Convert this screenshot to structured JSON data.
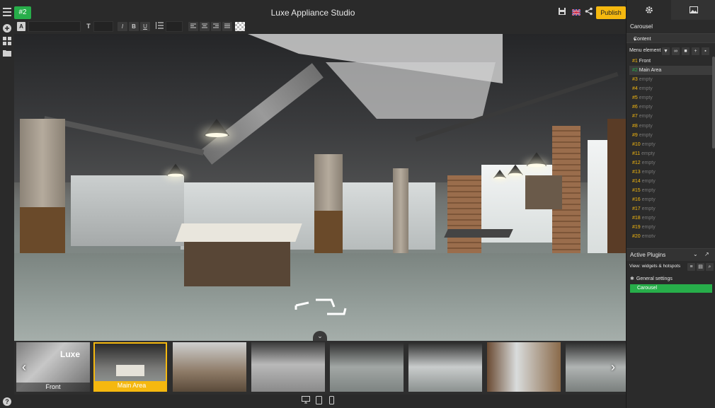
{
  "app": {
    "title": "Luxe Appliance Studio",
    "scene_badge": "#2",
    "publish_label": "Publish"
  },
  "icons": {
    "menu": "hamburger-icon",
    "save": "floppy-icon",
    "language": "uk-flag-icon",
    "share": "share-icon",
    "settings": "gear-icon",
    "image": "image-icon"
  },
  "right_panel": {
    "section_title": "Carousel",
    "content_header": "Content",
    "menu_element_label": "Menu element",
    "scenes": [
      {
        "num": "#1",
        "name": "Front",
        "filled": true
      },
      {
        "num": "#2",
        "name": "Main Area",
        "filled": true,
        "selected": true
      },
      {
        "num": "#3",
        "name": "empty"
      },
      {
        "num": "#4",
        "name": "empty"
      },
      {
        "num": "#5",
        "name": "empty"
      },
      {
        "num": "#6",
        "name": "empty"
      },
      {
        "num": "#7",
        "name": "empty"
      },
      {
        "num": "#8",
        "name": "empty"
      },
      {
        "num": "#9",
        "name": "empty"
      },
      {
        "num": "#10",
        "name": "empty"
      },
      {
        "num": "#11",
        "name": "empty"
      },
      {
        "num": "#12",
        "name": "empty"
      },
      {
        "num": "#13",
        "name": "empty"
      },
      {
        "num": "#14",
        "name": "empty"
      },
      {
        "num": "#15",
        "name": "empty"
      },
      {
        "num": "#16",
        "name": "empty"
      },
      {
        "num": "#17",
        "name": "empty"
      },
      {
        "num": "#18",
        "name": "empty"
      },
      {
        "num": "#19",
        "name": "empty"
      },
      {
        "num": "#20",
        "name": "empty"
      }
    ],
    "active_plugins_label": "Active Plugins",
    "view_label": "View: widgets & hotspots",
    "general_settings_label": "General settings",
    "carousel_plugin_label": "Carousel"
  },
  "carousel": {
    "thumbnails": [
      {
        "label": "Front",
        "active": false
      },
      {
        "label": "Main Area",
        "active": true
      },
      {
        "label": "",
        "active": false
      },
      {
        "label": "",
        "active": false
      },
      {
        "label": "",
        "active": false
      },
      {
        "label": "",
        "active": false
      },
      {
        "label": "",
        "active": false
      },
      {
        "label": "",
        "active": false
      }
    ],
    "prev_arrow": "‹",
    "next_arrow": "›"
  },
  "colors": {
    "accent_green": "#27ae4a",
    "accent_yellow": "#f5b80f",
    "panel_bg": "#2b2b2b"
  }
}
